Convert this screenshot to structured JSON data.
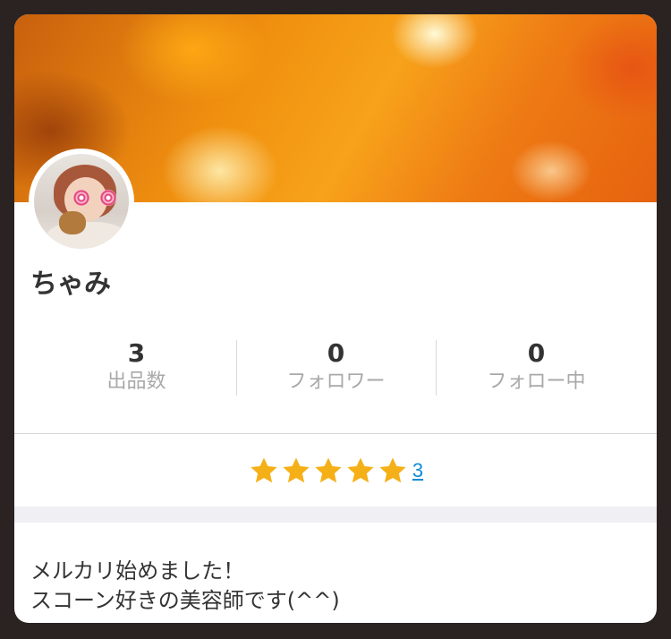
{
  "profile": {
    "name": "ちゃみ",
    "bio": "メルカリ始めました！\nスコーン好きの美容師です(^^)"
  },
  "stats": [
    {
      "value": "3",
      "label": "出品数"
    },
    {
      "value": "0",
      "label": "フォロワー"
    },
    {
      "value": "0",
      "label": "フォロー中"
    }
  ],
  "rating": {
    "stars": 5,
    "count": "3",
    "star_color": "#f5b018"
  },
  "icons": {
    "star": "star-icon",
    "avatar": "avatar-photo"
  }
}
